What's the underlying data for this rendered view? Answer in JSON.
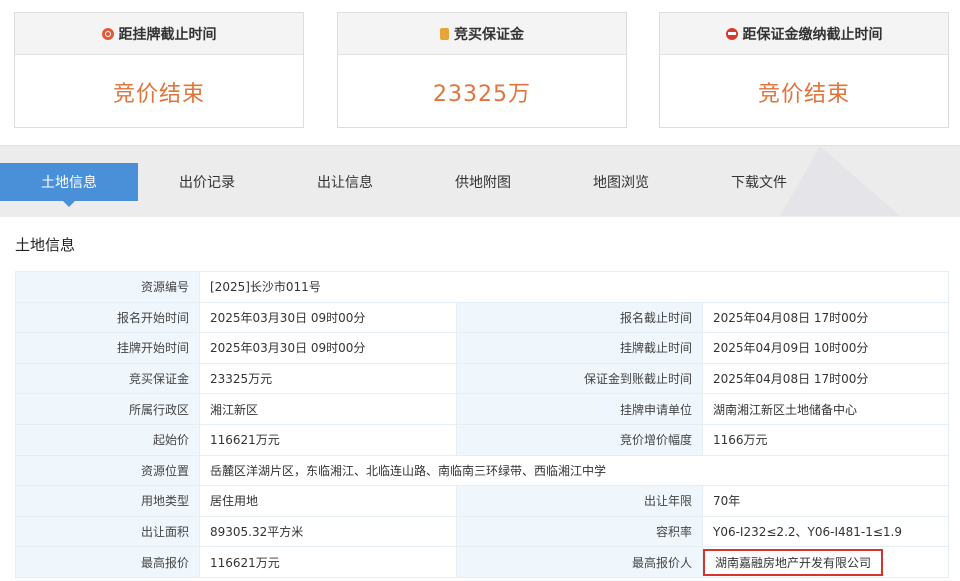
{
  "cards": [
    {
      "title": "距挂牌截止时间",
      "value": "竞价结束",
      "icon": "clock-icon"
    },
    {
      "title": "竞买保证金",
      "value": "23325万",
      "icon": "money-icon"
    },
    {
      "title": "距保证金缴纳截止时间",
      "value": "竞价结束",
      "icon": "alarm-icon"
    }
  ],
  "tabs": [
    "土地信息",
    "出价记录",
    "出让信息",
    "供地附图",
    "地图浏览",
    "下载文件"
  ],
  "section_title": "土地信息",
  "info": {
    "resource_no_label": "资源编号",
    "resource_no": "[2025]长沙市011号",
    "reg_start_label": "报名开始时间",
    "reg_start": "2025年03月30日 09时00分",
    "reg_end_label": "报名截止时间",
    "reg_end": "2025年04月08日 17时00分",
    "list_start_label": "挂牌开始时间",
    "list_start": "2025年03月30日 09时00分",
    "list_end_label": "挂牌截止时间",
    "list_end": "2025年04月09日 10时00分",
    "deposit_label": "竞买保证金",
    "deposit": "23325万元",
    "deposit_due_label": "保证金到账截止时间",
    "deposit_due": "2025年04月08日 17时00分",
    "district_label": "所属行政区",
    "district": "湘江新区",
    "applicant_unit_label": "挂牌申请单位",
    "applicant_unit": "湖南湘江新区土地储备中心",
    "start_price_label": "起始价",
    "start_price": "116621万元",
    "increment_label": "竞价增价幅度",
    "increment": "1166万元",
    "location_label": "资源位置",
    "location": "岳麓区洋湖片区，东临湘江、北临连山路、南临南三环绿带、西临湘江中学",
    "usage_label": "用地类型",
    "usage": "居住用地",
    "years_label": "出让年限",
    "years": "70年",
    "area_label": "出让面积",
    "area": "89305.32平方米",
    "far_label": "容积率",
    "far": "Y06-I232≤2.2、Y06-I481-1≤1.9",
    "top_price_label": "最高报价",
    "top_price": "116621万元",
    "top_bidder_label": "最高报价人",
    "top_bidder": "湖南嘉融房地产开发有限公司"
  },
  "colors": {
    "accent": "#4a90d9",
    "value": "#e0743a",
    "highlight": "#d9342b"
  }
}
